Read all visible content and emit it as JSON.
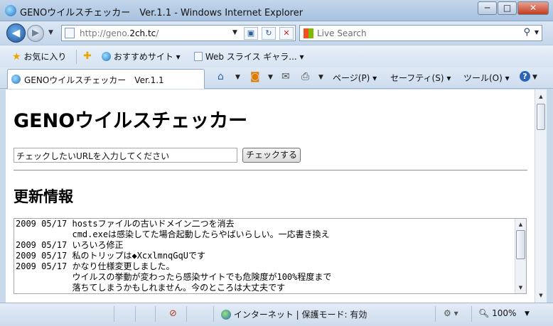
{
  "window": {
    "title": "GENOウイルスチェッカー　Ver.1.1 - Windows Internet Explorer",
    "minimize": "─",
    "maximize": "□",
    "close": "✕"
  },
  "address_bar": {
    "url_prefix": "http://geno.",
    "url_host": "2ch.tc",
    "url_suffix": "/"
  },
  "search": {
    "placeholder": "Live Search"
  },
  "favorites_bar": {
    "favorites_label": "お気に入り",
    "items": [
      {
        "label": "おすすめサイト ▾"
      },
      {
        "label": "Web スライス ギャラ... ▾"
      }
    ]
  },
  "tab": {
    "label": "GENOウイルスチェッカー　Ver.1.1"
  },
  "command_bar": {
    "page": "ページ(P) ▾",
    "safety": "セーフティ(S) ▾",
    "tools": "ツール(O) ▾"
  },
  "page": {
    "title": "GENOウイルスチェッカー",
    "url_input_value": "チェックしたいURLを入力してください",
    "check_button": "チェックする",
    "section_title": "更新情報",
    "news": [
      "2009 05/17 hostsファイルの古いドメイン二つを消去",
      "           cmd.exeは感染してた場合起動したらやばいらしい。一応書き換え",
      "2009 05/17 いろいろ修正",
      "2009 05/17 私のトリップは◆XcxlmnqGqUです",
      "2009 05/17 かなり仕様変更しました。",
      "           ウイルスの挙動が変わったら感染サイトでも危険度が100%程度まで",
      "           落ちてしまうかもしれません。今のところは大丈夫です"
    ]
  },
  "status_bar": {
    "zone": "インターネット | 保護モード: 有効",
    "zoom": "100%"
  }
}
